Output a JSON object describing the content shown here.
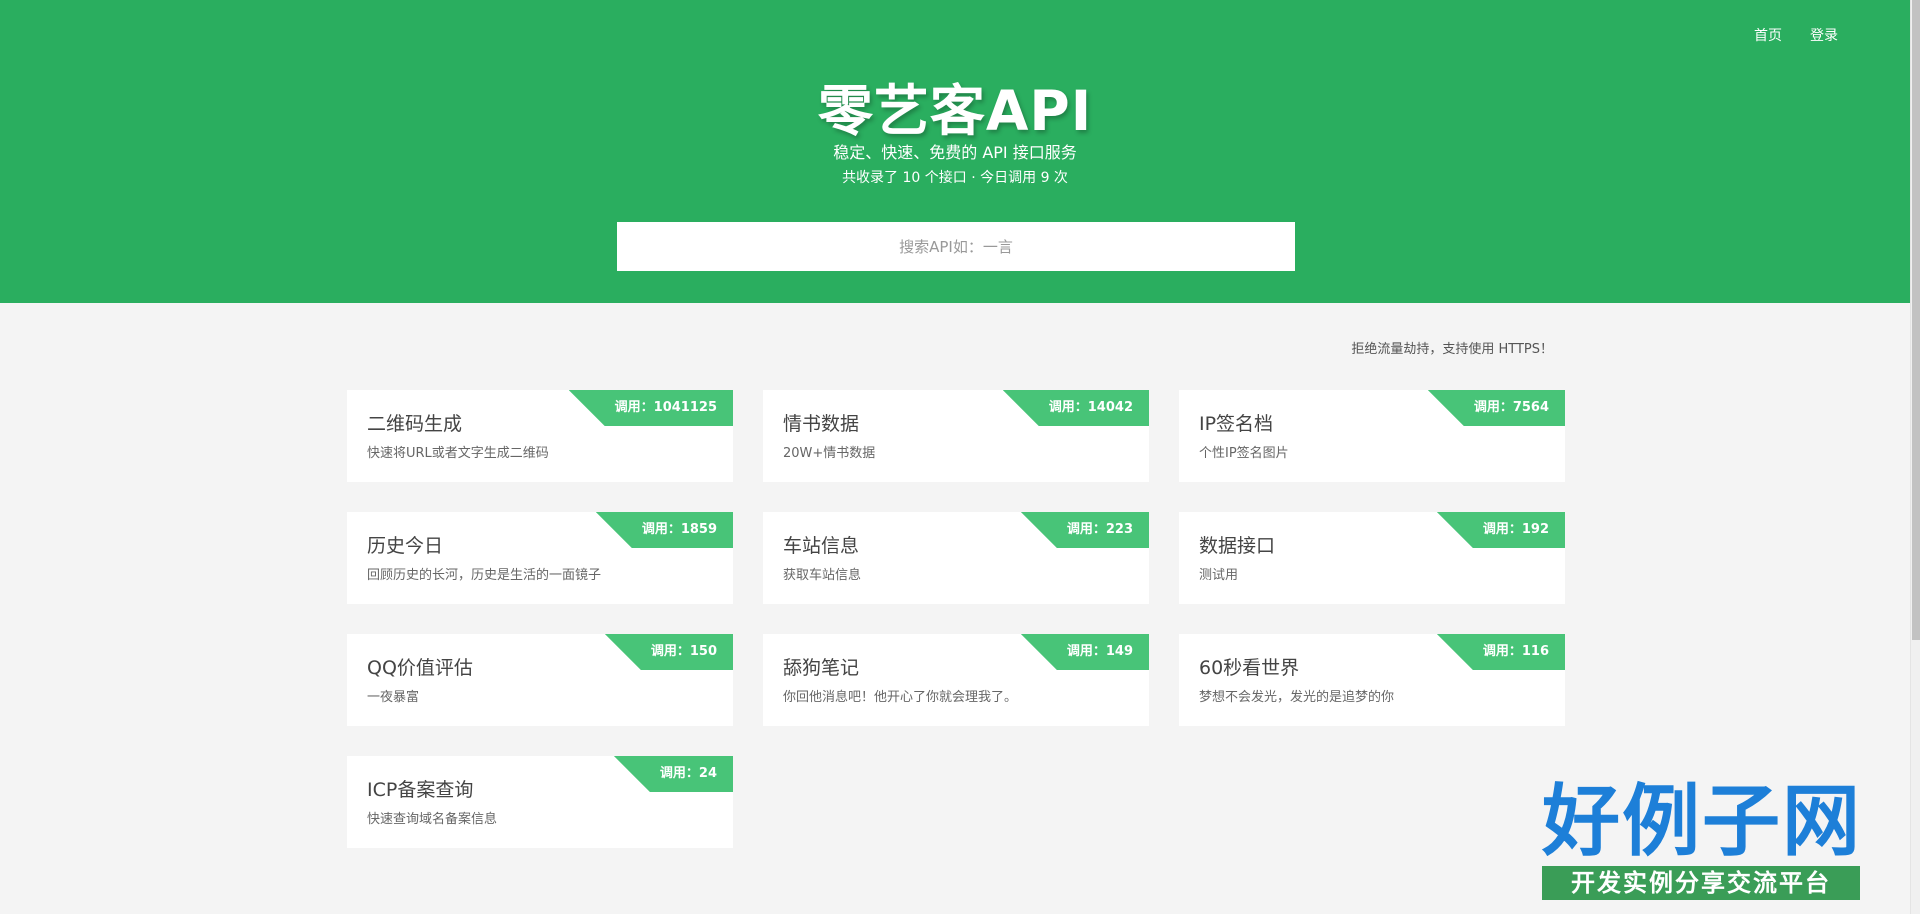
{
  "nav": {
    "home_label": "首页",
    "login_label": "登录"
  },
  "header": {
    "title": "零艺客API",
    "subtitle": "稳定、快速、免费的 API 接口服务",
    "stats": "共收录了 10 个接口 · 今日调用 9 次"
  },
  "search": {
    "placeholder": "搜索API如：一言",
    "value": ""
  },
  "notice": "拒绝流量劫持，支持使用 HTTPS！",
  "cards": [
    {
      "title": "二维码生成",
      "desc": "快速将URL或者文字生成二维码",
      "calls": "调用：1041125"
    },
    {
      "title": "情书数据",
      "desc": "20W+情书数据",
      "calls": "调用：14042"
    },
    {
      "title": "IP签名档",
      "desc": "个性IP签名图片",
      "calls": "调用：7564"
    },
    {
      "title": "历史今日",
      "desc": "回顾历史的长河，历史是生活的一面镜子",
      "calls": "调用：1859"
    },
    {
      "title": "车站信息",
      "desc": "获取车站信息",
      "calls": "调用：223"
    },
    {
      "title": "数据接口",
      "desc": "测试用",
      "calls": "调用：192"
    },
    {
      "title": "QQ价值评估",
      "desc": "一夜暴富",
      "calls": "调用：150"
    },
    {
      "title": "舔狗笔记",
      "desc": "你回他消息吧！他开心了你就会理我了。",
      "calls": "调用：149"
    },
    {
      "title": "60秒看世界",
      "desc": "梦想不会发光，发光的是追梦的你",
      "calls": "调用：116"
    },
    {
      "title": "ICP备案查询",
      "desc": "快速查询域名备案信息",
      "calls": "调用：24"
    }
  ],
  "watermark": {
    "title": "好例子网",
    "subtitle": "开发实例分享交流平台"
  },
  "colors": {
    "header_bg": "#2aae5f",
    "badge_bg": "#48c478",
    "page_bg": "#f4f4f4"
  }
}
